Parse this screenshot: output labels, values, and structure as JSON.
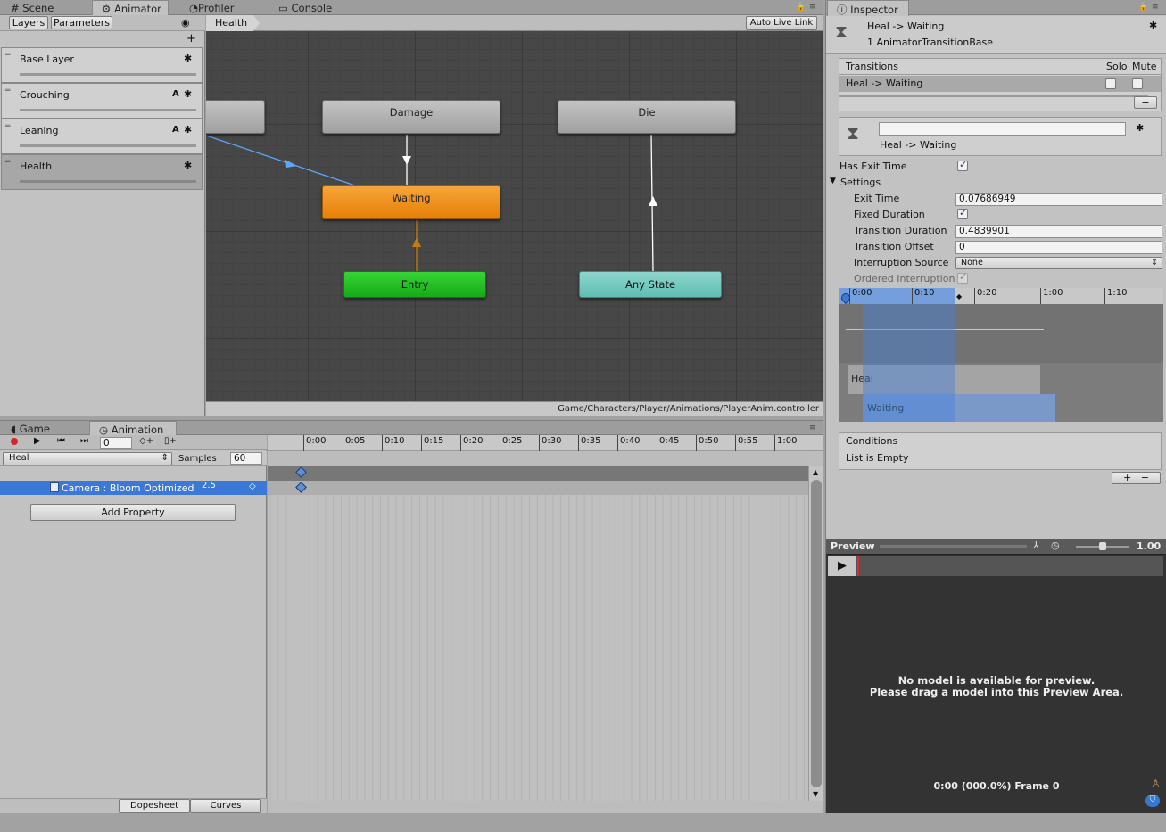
{
  "top_tabs": {
    "scene": "Scene",
    "animator": "Animator",
    "profiler": "Profiler",
    "console": "Console",
    "inspector": "Inspector"
  },
  "animator": {
    "sub_tabs": [
      "Layers",
      "Parameters"
    ],
    "layers": [
      {
        "name": "Base Layer",
        "a": ""
      },
      {
        "name": "Crouching",
        "a": "A"
      },
      {
        "name": "Leaning",
        "a": "A"
      },
      {
        "name": "Health",
        "a": ""
      }
    ],
    "breadcrumb": "Health",
    "auto_live_link": "Auto Live Link",
    "states": {
      "damage": "Damage",
      "die": "Die",
      "waiting": "Waiting",
      "entry": "Entry",
      "any_state": "Any State"
    },
    "path": "Game/Characters/Player/Animations/PlayerAnim.controller"
  },
  "animation": {
    "tabs": {
      "game": "Game",
      "animation": "Animation"
    },
    "frame": "0",
    "clip": "Heal",
    "samples_label": "Samples",
    "samples": "60",
    "property": "Camera : Bloom Optimized",
    "property_value": "2.5",
    "add_property": "Add Property",
    "ticks": [
      "0:00",
      "0:05",
      "0:10",
      "0:15",
      "0:20",
      "0:25",
      "0:30",
      "0:35",
      "0:40",
      "0:45",
      "0:50",
      "0:55",
      "1:00"
    ],
    "bottom_tabs": {
      "dopesheet": "Dopesheet",
      "curves": "Curves"
    }
  },
  "inspector": {
    "title": "Heal -> Waiting",
    "subtitle": "1 AnimatorTransitionBase",
    "transitions_label": "Transitions",
    "solo": "Solo",
    "mute": "Mute",
    "transition_row": "Heal -> Waiting",
    "detail_name": "Heal -> Waiting",
    "has_exit_time_label": "Has Exit Time",
    "settings_label": "Settings",
    "fields": [
      {
        "label": "Exit Time",
        "value": "0.07686949"
      },
      {
        "label": "Fixed Duration",
        "value": ""
      },
      {
        "label": "Transition Duration",
        "value": "0.4839901"
      },
      {
        "label": "Transition Offset",
        "value": "0"
      },
      {
        "label": "Interruption Source",
        "value": "None"
      },
      {
        "label": "Ordered Interruption",
        "value": ""
      }
    ],
    "timeline_ticks": [
      "0:00",
      "0:10",
      "0:20",
      "1:00",
      "1:10"
    ],
    "tl_clip_a": "Heal",
    "tl_clip_b": "Waiting",
    "conditions_label": "Conditions",
    "conditions_empty": "List is Empty",
    "preview_label": "Preview",
    "preview_speed": "1.00",
    "preview_msg1": "No model is available for preview.",
    "preview_msg2": "Please drag a model into this Preview Area.",
    "preview_time": "0:00 (000.0%) Frame 0"
  },
  "colors": {
    "waiting": "#f08a10",
    "entry": "#22b622",
    "any_state": "#6fc7bd",
    "selection": "#3c78d8"
  }
}
